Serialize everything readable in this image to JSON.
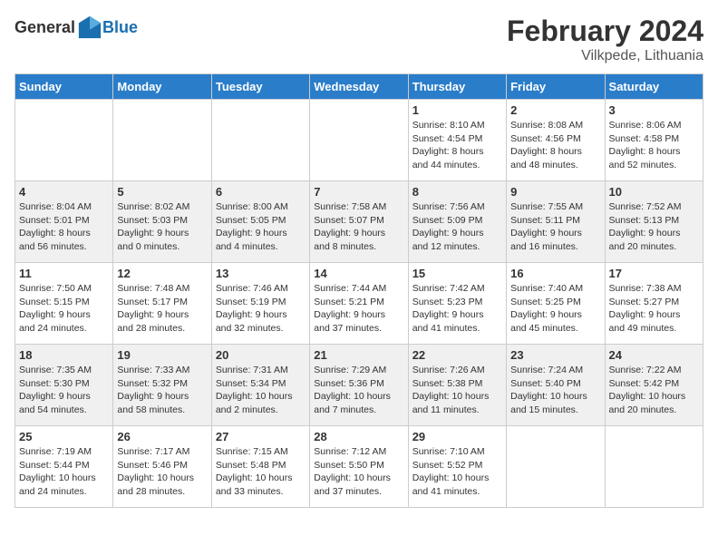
{
  "header": {
    "logo_general": "General",
    "logo_blue": "Blue",
    "month": "February 2024",
    "location": "Vilkpede, Lithuania"
  },
  "weekdays": [
    "Sunday",
    "Monday",
    "Tuesday",
    "Wednesday",
    "Thursday",
    "Friday",
    "Saturday"
  ],
  "weeks": [
    [
      {
        "day": "",
        "info": ""
      },
      {
        "day": "",
        "info": ""
      },
      {
        "day": "",
        "info": ""
      },
      {
        "day": "",
        "info": ""
      },
      {
        "day": "1",
        "info": "Sunrise: 8:10 AM\nSunset: 4:54 PM\nDaylight: 8 hours\nand 44 minutes."
      },
      {
        "day": "2",
        "info": "Sunrise: 8:08 AM\nSunset: 4:56 PM\nDaylight: 8 hours\nand 48 minutes."
      },
      {
        "day": "3",
        "info": "Sunrise: 8:06 AM\nSunset: 4:58 PM\nDaylight: 8 hours\nand 52 minutes."
      }
    ],
    [
      {
        "day": "4",
        "info": "Sunrise: 8:04 AM\nSunset: 5:01 PM\nDaylight: 8 hours\nand 56 minutes."
      },
      {
        "day": "5",
        "info": "Sunrise: 8:02 AM\nSunset: 5:03 PM\nDaylight: 9 hours\nand 0 minutes."
      },
      {
        "day": "6",
        "info": "Sunrise: 8:00 AM\nSunset: 5:05 PM\nDaylight: 9 hours\nand 4 minutes."
      },
      {
        "day": "7",
        "info": "Sunrise: 7:58 AM\nSunset: 5:07 PM\nDaylight: 9 hours\nand 8 minutes."
      },
      {
        "day": "8",
        "info": "Sunrise: 7:56 AM\nSunset: 5:09 PM\nDaylight: 9 hours\nand 12 minutes."
      },
      {
        "day": "9",
        "info": "Sunrise: 7:55 AM\nSunset: 5:11 PM\nDaylight: 9 hours\nand 16 minutes."
      },
      {
        "day": "10",
        "info": "Sunrise: 7:52 AM\nSunset: 5:13 PM\nDaylight: 9 hours\nand 20 minutes."
      }
    ],
    [
      {
        "day": "11",
        "info": "Sunrise: 7:50 AM\nSunset: 5:15 PM\nDaylight: 9 hours\nand 24 minutes."
      },
      {
        "day": "12",
        "info": "Sunrise: 7:48 AM\nSunset: 5:17 PM\nDaylight: 9 hours\nand 28 minutes."
      },
      {
        "day": "13",
        "info": "Sunrise: 7:46 AM\nSunset: 5:19 PM\nDaylight: 9 hours\nand 32 minutes."
      },
      {
        "day": "14",
        "info": "Sunrise: 7:44 AM\nSunset: 5:21 PM\nDaylight: 9 hours\nand 37 minutes."
      },
      {
        "day": "15",
        "info": "Sunrise: 7:42 AM\nSunset: 5:23 PM\nDaylight: 9 hours\nand 41 minutes."
      },
      {
        "day": "16",
        "info": "Sunrise: 7:40 AM\nSunset: 5:25 PM\nDaylight: 9 hours\nand 45 minutes."
      },
      {
        "day": "17",
        "info": "Sunrise: 7:38 AM\nSunset: 5:27 PM\nDaylight: 9 hours\nand 49 minutes."
      }
    ],
    [
      {
        "day": "18",
        "info": "Sunrise: 7:35 AM\nSunset: 5:30 PM\nDaylight: 9 hours\nand 54 minutes."
      },
      {
        "day": "19",
        "info": "Sunrise: 7:33 AM\nSunset: 5:32 PM\nDaylight: 9 hours\nand 58 minutes."
      },
      {
        "day": "20",
        "info": "Sunrise: 7:31 AM\nSunset: 5:34 PM\nDaylight: 10 hours\nand 2 minutes."
      },
      {
        "day": "21",
        "info": "Sunrise: 7:29 AM\nSunset: 5:36 PM\nDaylight: 10 hours\nand 7 minutes."
      },
      {
        "day": "22",
        "info": "Sunrise: 7:26 AM\nSunset: 5:38 PM\nDaylight: 10 hours\nand 11 minutes."
      },
      {
        "day": "23",
        "info": "Sunrise: 7:24 AM\nSunset: 5:40 PM\nDaylight: 10 hours\nand 15 minutes."
      },
      {
        "day": "24",
        "info": "Sunrise: 7:22 AM\nSunset: 5:42 PM\nDaylight: 10 hours\nand 20 minutes."
      }
    ],
    [
      {
        "day": "25",
        "info": "Sunrise: 7:19 AM\nSunset: 5:44 PM\nDaylight: 10 hours\nand 24 minutes."
      },
      {
        "day": "26",
        "info": "Sunrise: 7:17 AM\nSunset: 5:46 PM\nDaylight: 10 hours\nand 28 minutes."
      },
      {
        "day": "27",
        "info": "Sunrise: 7:15 AM\nSunset: 5:48 PM\nDaylight: 10 hours\nand 33 minutes."
      },
      {
        "day": "28",
        "info": "Sunrise: 7:12 AM\nSunset: 5:50 PM\nDaylight: 10 hours\nand 37 minutes."
      },
      {
        "day": "29",
        "info": "Sunrise: 7:10 AM\nSunset: 5:52 PM\nDaylight: 10 hours\nand 41 minutes."
      },
      {
        "day": "",
        "info": ""
      },
      {
        "day": "",
        "info": ""
      }
    ]
  ]
}
